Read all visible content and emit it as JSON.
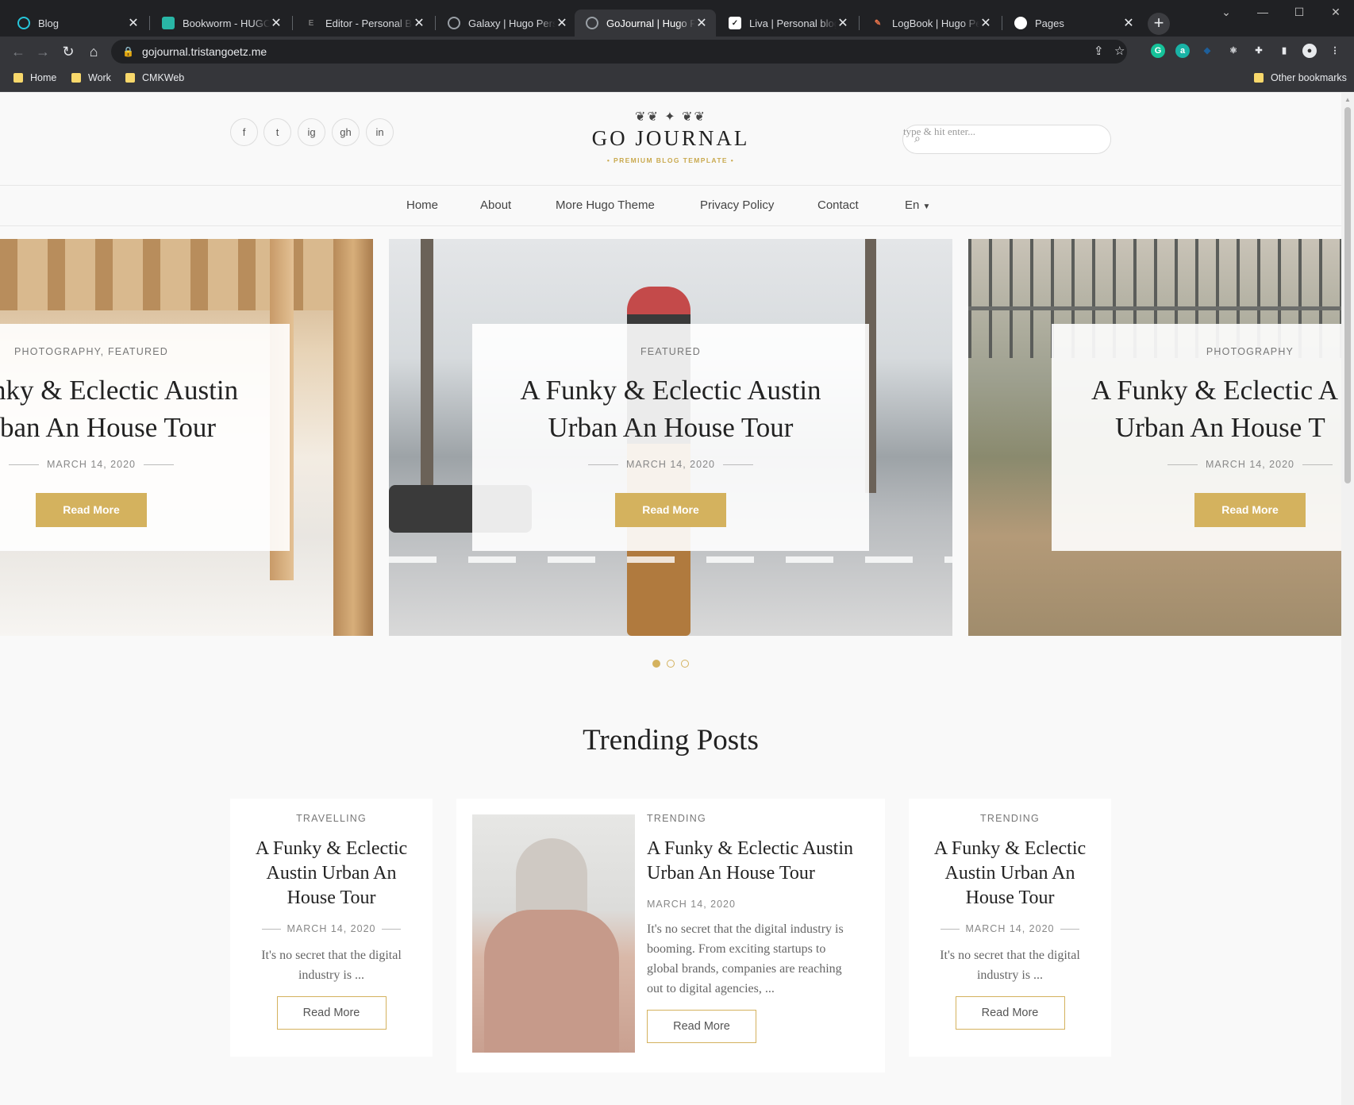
{
  "browser": {
    "tabs": [
      {
        "title": "Blog",
        "icon": "hugo-icon",
        "color": "#26c6da"
      },
      {
        "title": "Bookworm - HUGO Blog",
        "icon": "bookworm-icon",
        "color": "#29b6a6"
      },
      {
        "title": "Editor - Personal Blog",
        "icon": "editor-icon",
        "color": "#555555"
      },
      {
        "title": "Galaxy | Hugo Personal",
        "icon": "globe-icon",
        "color": "#9aa0a6"
      },
      {
        "title": "GoJournal | Hugo Personal",
        "icon": "globe-icon",
        "color": "#9aa0a6"
      },
      {
        "title": "Liva | Personal blog template",
        "icon": "liva-icon",
        "color": "#ffffff"
      },
      {
        "title": "LogBook | Hugo Personal",
        "icon": "pen-icon",
        "color": "#e8734a"
      },
      {
        "title": "Pages",
        "icon": "github-icon",
        "color": "#ffffff"
      }
    ],
    "active_tab": 4,
    "url": "gojournal.tristangoetz.me",
    "bookmarks": [
      "Home",
      "Work",
      "CMKWeb"
    ],
    "other_bookmarks": "Other bookmarks"
  },
  "header": {
    "social": [
      "f",
      "t",
      "ig",
      "gh",
      "in"
    ],
    "logo_name": "GO JOURNAL",
    "logo_tagline": "• PREMIUM BLOG TEMPLATE •",
    "search_placeholder": "type & hit enter..."
  },
  "nav": {
    "items": [
      "Home",
      "About",
      "More Hugo Theme",
      "Privacy Policy",
      "Contact"
    ],
    "lang": "En"
  },
  "slider": {
    "slides": [
      {
        "category": "PHOTOGRAPHY, FEATURED",
        "title_l1": "nky & Eclectic Austin",
        "title_l2": "ban An House Tour",
        "date": "MARCH 14, 2020",
        "button": "Read More"
      },
      {
        "category": "FEATURED",
        "title_l1": "A Funky & Eclectic Austin",
        "title_l2": "Urban An House Tour",
        "date": "MARCH 14, 2020",
        "button": "Read More"
      },
      {
        "category": "PHOTOGRAPHY",
        "title_l1": "A Funky & Eclectic A",
        "title_l2": "Urban An House T",
        "date": "MARCH 14, 2020",
        "button": "Read More"
      }
    ],
    "active_dot": 0
  },
  "trending": {
    "heading": "Trending Posts",
    "posts": [
      {
        "category": "TRAVELLING",
        "title": [
          "A Funky & Eclectic",
          "Austin Urban An",
          "House Tour"
        ],
        "date": "MARCH 14, 2020",
        "excerpt": [
          "It's no secret that the digital",
          "industry is ..."
        ],
        "button": "Read More"
      },
      {
        "category": "TRENDING",
        "title": [
          "A Funky & Eclectic Austin",
          "Urban An House Tour"
        ],
        "date": "MARCH 14, 2020",
        "excerpt": [
          "It's no secret that the digital industry is",
          "booming. From exciting startups to",
          "global brands, companies are reaching",
          "out to digital agencies, ..."
        ],
        "button": "Read More"
      },
      {
        "category": "TRENDING",
        "title": [
          "A Funky & Eclectic",
          "Austin Urban An",
          "House Tour"
        ],
        "date": "MARCH 14, 2020",
        "excerpt": [
          "It's no secret that the digital",
          "industry is ..."
        ],
        "button": "Read More"
      }
    ]
  },
  "colors": {
    "accent": "#d4b25e",
    "chrome_dark": "#202124",
    "chrome_mid": "#35363a"
  }
}
